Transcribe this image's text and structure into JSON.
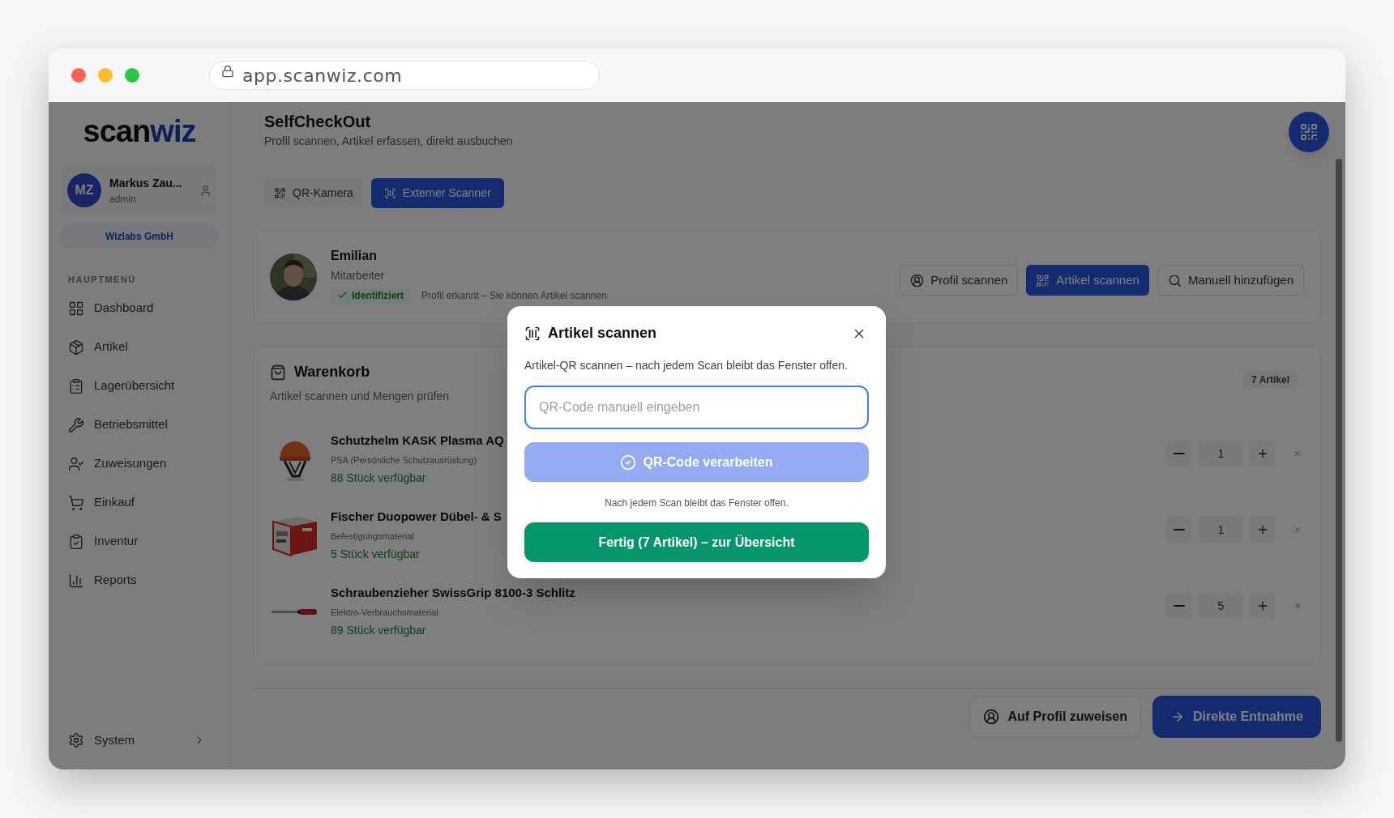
{
  "browser": {
    "url": "app.scanwiz.com"
  },
  "sidebar": {
    "logo": {
      "prefix": "scan",
      "suffix": "wiz"
    },
    "user": {
      "initials": "MZ",
      "name": "Markus Zau...",
      "role": "admin"
    },
    "organization": "Wizlabs GmbH",
    "section_label": "HAUPTMENÜ",
    "items": [
      {
        "label": "Dashboard"
      },
      {
        "label": "Artikel"
      },
      {
        "label": "Lagerübersicht"
      },
      {
        "label": "Betriebsmittel"
      },
      {
        "label": "Zuweisungen"
      },
      {
        "label": "Einkauf"
      },
      {
        "label": "Inventur"
      },
      {
        "label": "Reports"
      }
    ],
    "footer_item": {
      "label": "System"
    }
  },
  "header": {
    "title": "SelfCheckOut",
    "subtitle": "Profil scannen, Artikel erfassen, direkt ausbuchen"
  },
  "mode_tabs": [
    {
      "label": "QR-Kamera",
      "selected": false
    },
    {
      "label": "Externer Scanner",
      "selected": true
    }
  ],
  "profile": {
    "name": "Emilian",
    "role": "Mitarbeiter",
    "status_badge": "Identifiziert",
    "status_text": "Profil erkannt – Sie können Artikel scannen",
    "actions": [
      {
        "label": "Profil scannen",
        "selected": false
      },
      {
        "label": "Artikel scannen",
        "selected": true
      },
      {
        "label": "Manuell hinzufügen",
        "selected": false
      }
    ]
  },
  "cart": {
    "title": "Warenkorb",
    "subtitle": "Artikel scannen und Mengen prüfen",
    "count_badge": "7 Artikel",
    "items": [
      {
        "name": "Schutzhelm KASK Plasma AQ",
        "category": "PSA (Persönliche Schutzausrüstung)",
        "availability": "88 Stück verfügbar",
        "quantity": "1"
      },
      {
        "name": "Fischer Duopower Dübel- & S",
        "category": "Befestigungsmaterial",
        "availability": "5 Stück verfügbar",
        "quantity": "1"
      },
      {
        "name": "Schraubenzieher SwissGrip 8100-3 Schlitz",
        "category": "Elektro-Verbrauchsmaterial",
        "availability": "89 Stück verfügbar",
        "quantity": "5"
      }
    ]
  },
  "footer_actions": [
    {
      "label": "Auf Profil zuweisen",
      "kind": "outline"
    },
    {
      "label": "Direkte Entnahme",
      "kind": "primary"
    }
  ],
  "modal": {
    "title": "Artikel scannen",
    "description": "Artikel-QR scannen – nach jedem Scan bleibt das Fenster offen.",
    "input": {
      "placeholder": "QR-Code manuell eingeben"
    },
    "process_button": {
      "label": "QR-Code verarbeiten",
      "disabled": true
    },
    "note": "Nach jedem Scan bleibt das Fenster offen.",
    "done_button": {
      "label": "Fertig (7 Artikel) – zur Übersicht"
    }
  }
}
